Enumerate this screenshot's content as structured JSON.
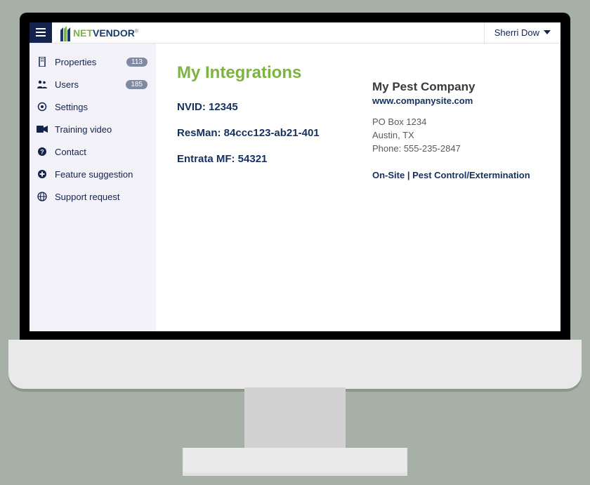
{
  "header": {
    "logo_part1": "NET",
    "logo_part2": "VENDOR",
    "user_name": "Sherri Dow"
  },
  "sidebar": {
    "items": [
      {
        "label": "Properties",
        "badge": "113",
        "icon": "building-icon"
      },
      {
        "label": "Users",
        "badge": "185",
        "icon": "users-icon"
      },
      {
        "label": "Settings",
        "badge": "",
        "icon": "gear-icon"
      },
      {
        "label": "Training video",
        "badge": "",
        "icon": "video-icon"
      },
      {
        "label": "Contact",
        "badge": "",
        "icon": "question-icon"
      },
      {
        "label": "Feature suggestion",
        "badge": "",
        "icon": "plus-circle-icon"
      },
      {
        "label": "Support request",
        "badge": "",
        "icon": "globe-icon"
      }
    ]
  },
  "main": {
    "title": "My Integrations",
    "integrations": {
      "nvid": "NVID: 12345",
      "resman": "ResMan: 84ccc123-ab21-401",
      "entrata": "Entrata MF: 54321"
    },
    "company": {
      "name": "My Pest Company",
      "website": "www.companysite.com",
      "address1": "PO Box 1234",
      "address2": "Austin, TX",
      "phone": "Phone: 555-235-2847",
      "category": "On-Site | Pest Control/Extermination"
    }
  }
}
